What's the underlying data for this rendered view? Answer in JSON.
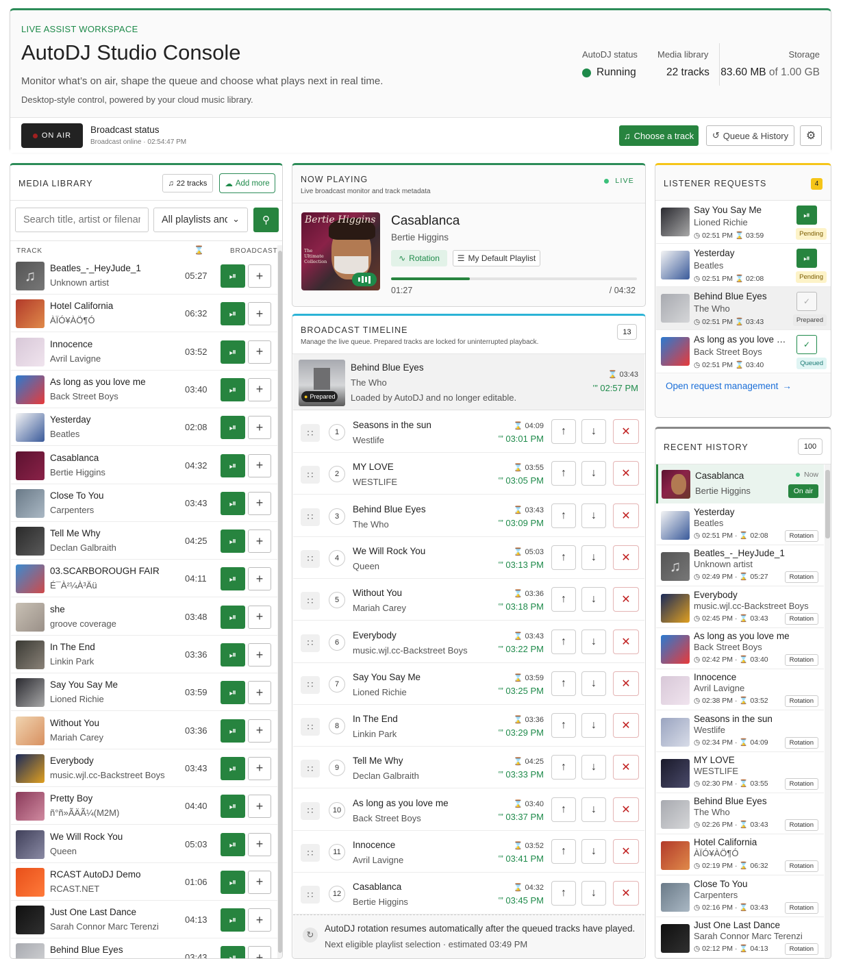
{
  "header": {
    "workspace_label": "LIVE ASSIST WORKSPACE",
    "title": "AutoDJ Studio Console",
    "subtitle": "Monitor what’s on air, shape the queue and choose what plays next in real time.",
    "subtitle2": "Desktop-style control, powered by your cloud music library.",
    "autodj_status_label": "AutoDJ status",
    "autodj_status_value": "Running",
    "media_library_label": "Media library",
    "media_library_value": "22 tracks",
    "storage_label": "Storage",
    "storage_used": "83.60 MB",
    "storage_of": "of 1.00 GB"
  },
  "toolbar": {
    "on_air": "ON AIR",
    "broadcast_status_title": "Broadcast status",
    "broadcast_status_sub": "Broadcast online · 02:54:47 PM",
    "choose_track": "Choose a track",
    "queue_history": "Queue & History"
  },
  "library": {
    "title": "MEDIA LIBRARY",
    "count": "22 tracks",
    "add_more": "Add more",
    "search_placeholder": "Search title, artist or filename",
    "playlist_select": "All playlists and tracks",
    "col_track": "TRACK",
    "col_broadcast": "BROADCAST",
    "tracks": [
      {
        "title": "Beatles_-_HeyJude_1",
        "artist": "Unknown artist",
        "duration": "05:27"
      },
      {
        "title": "Hotel California",
        "artist": "ÀÏÓ¥ÀÖ¶Ó",
        "duration": "06:32"
      },
      {
        "title": "Innocence",
        "artist": "Avril Lavigne",
        "duration": "03:52"
      },
      {
        "title": "As long as you love me",
        "artist": "Back Street Boys",
        "duration": "03:40"
      },
      {
        "title": "Yesterday",
        "artist": "Beatles",
        "duration": "02:08"
      },
      {
        "title": "Casablanca",
        "artist": "Bertie Higgins",
        "duration": "04:32"
      },
      {
        "title": "Close To You",
        "artist": "Carpenters",
        "duration": "03:43"
      },
      {
        "title": "Tell Me Why",
        "artist": "Declan Galbraith",
        "duration": "04:25"
      },
      {
        "title": "03.SCARBOROUGH FAIR",
        "artist": "É¯À²¼À³Äü",
        "duration": "04:11"
      },
      {
        "title": "she",
        "artist": "groove coverage",
        "duration": "03:48"
      },
      {
        "title": "In The End",
        "artist": "Linkin Park",
        "duration": "03:36"
      },
      {
        "title": "Say You Say Me",
        "artist": "Lioned Richie",
        "duration": "03:59"
      },
      {
        "title": "Without You",
        "artist": "Mariah Carey",
        "duration": "03:36"
      },
      {
        "title": "Everybody",
        "artist": "music.wjl.cc-Backstreet Boys",
        "duration": "03:43"
      },
      {
        "title": "Pretty Boy",
        "artist": "ñ°ñ»ÃÄÃ¼(M2M)",
        "duration": "04:40"
      },
      {
        "title": "We Will Rock You",
        "artist": "Queen",
        "duration": "05:03"
      },
      {
        "title": "RCAST AutoDJ Demo",
        "artist": "RCAST.NET",
        "duration": "01:06"
      },
      {
        "title": "Just One Last Dance",
        "artist": "Sarah Connor Marc Terenzi",
        "duration": "04:13"
      },
      {
        "title": "Behind Blue Eyes",
        "artist": "",
        "duration": "03:43"
      }
    ]
  },
  "now_playing": {
    "title": "NOW PLAYING",
    "subtitle": "Live broadcast monitor and track metadata",
    "live": "LIVE",
    "track": "Casablanca",
    "artist": "Bertie Higgins",
    "tag_rotation": "Rotation",
    "tag_playlist": "My Default Playlist",
    "elapsed": "01:27",
    "total": "/ 04:32",
    "progress": 0.32,
    "art_text": "Bertie Higgins",
    "art_small": "The Ultimate Collection"
  },
  "timeline": {
    "title": "BROADCAST TIMELINE",
    "subtitle": "Manage the live queue. Prepared tracks are locked for uninterrupted playback.",
    "count": "13",
    "prepared": {
      "title": "Behind Blue Eyes",
      "artist": "The Who",
      "note": "Loaded by AutoDJ and no longer editable.",
      "duration": "03:43",
      "eta": "02:57 PM",
      "badge": "Prepared"
    },
    "items": [
      {
        "n": "1",
        "title": "Seasons in the sun",
        "artist": "Westlife",
        "duration": "04:09",
        "eta": "03:01 PM"
      },
      {
        "n": "2",
        "title": "MY LOVE",
        "artist": "WESTLIFE",
        "duration": "03:55",
        "eta": "03:05 PM"
      },
      {
        "n": "3",
        "title": "Behind Blue Eyes",
        "artist": "The Who",
        "duration": "03:43",
        "eta": "03:09 PM"
      },
      {
        "n": "4",
        "title": "We Will Rock You",
        "artist": "Queen",
        "duration": "05:03",
        "eta": "03:13 PM"
      },
      {
        "n": "5",
        "title": "Without You",
        "artist": "Mariah Carey",
        "duration": "03:36",
        "eta": "03:18 PM"
      },
      {
        "n": "6",
        "title": "Everybody",
        "artist": "music.wjl.cc-Backstreet Boys",
        "duration": "03:43",
        "eta": "03:22 PM"
      },
      {
        "n": "7",
        "title": "Say You Say Me",
        "artist": "Lioned Richie",
        "duration": "03:59",
        "eta": "03:25 PM"
      },
      {
        "n": "8",
        "title": "In The End",
        "artist": "Linkin Park",
        "duration": "03:36",
        "eta": "03:29 PM"
      },
      {
        "n": "9",
        "title": "Tell Me Why",
        "artist": "Declan Galbraith",
        "duration": "04:25",
        "eta": "03:33 PM"
      },
      {
        "n": "10",
        "title": "As long as you love me",
        "artist": "Back Street Boys",
        "duration": "03:40",
        "eta": "03:37 PM"
      },
      {
        "n": "11",
        "title": "Innocence",
        "artist": "Avril Lavigne",
        "duration": "03:52",
        "eta": "03:41 PM"
      },
      {
        "n": "12",
        "title": "Casablanca",
        "artist": "Bertie Higgins",
        "duration": "04:32",
        "eta": "03:45 PM"
      }
    ],
    "footer_main": "AutoDJ rotation resumes automatically after the queued tracks have played.",
    "footer_sub": "Next eligible playlist selection · estimated 03:49 PM"
  },
  "requests": {
    "title": "LISTENER REQUESTS",
    "count": "4",
    "items": [
      {
        "title": "Say You Say Me",
        "artist": "Lioned Richie",
        "time": "02:51 PM",
        "duration": "03:59",
        "status": "Pending"
      },
      {
        "title": "Yesterday",
        "artist": "Beatles",
        "time": "02:51 PM",
        "duration": "02:08",
        "status": "Pending"
      },
      {
        "title": "Behind Blue Eyes",
        "artist": "The Who",
        "time": "02:51 PM",
        "duration": "03:43",
        "status": "Prepared"
      },
      {
        "title": "As long as you love …",
        "artist": "Back Street Boys",
        "time": "02:51 PM",
        "duration": "03:40",
        "status": "Queued"
      }
    ],
    "open_link": "Open request management"
  },
  "history": {
    "title": "RECENT HISTORY",
    "count": "100",
    "current": {
      "title": "Casablanca",
      "artist": "Bertie Higgins",
      "now": "Now",
      "badge": "On air"
    },
    "items": [
      {
        "title": "Yesterday",
        "artist": "Beatles",
        "time": "02:51 PM",
        "duration": "02:08",
        "tag": "Rotation"
      },
      {
        "title": "Beatles_-_HeyJude_1",
        "artist": "Unknown artist",
        "time": "02:49 PM",
        "duration": "05:27",
        "tag": "Rotation"
      },
      {
        "title": "Everybody",
        "artist": "music.wjl.cc-Backstreet Boys",
        "time": "02:45 PM",
        "duration": "03:43",
        "tag": "Rotation"
      },
      {
        "title": "As long as you love me",
        "artist": "Back Street Boys",
        "time": "02:42 PM",
        "duration": "03:40",
        "tag": "Rotation"
      },
      {
        "title": "Innocence",
        "artist": "Avril Lavigne",
        "time": "02:38 PM",
        "duration": "03:52",
        "tag": "Rotation"
      },
      {
        "title": "Seasons in the sun",
        "artist": "Westlife",
        "time": "02:34 PM",
        "duration": "04:09",
        "tag": "Rotation"
      },
      {
        "title": "MY LOVE",
        "artist": "WESTLIFE",
        "time": "02:30 PM",
        "duration": "03:55",
        "tag": "Rotation"
      },
      {
        "title": "Behind Blue Eyes",
        "artist": "The Who",
        "time": "02:26 PM",
        "duration": "03:43",
        "tag": "Rotation"
      },
      {
        "title": "Hotel California",
        "artist": "ÀÏÓ¥ÀÖ¶Ó",
        "time": "02:19 PM",
        "duration": "06:32",
        "tag": "Rotation"
      },
      {
        "title": "Close To You",
        "artist": "Carpenters",
        "time": "02:16 PM",
        "duration": "03:43",
        "tag": "Rotation"
      },
      {
        "title": "Just One Last Dance",
        "artist": "Sarah Connor Marc Terenzi",
        "time": "02:12 PM",
        "duration": "04:13",
        "tag": "Rotation"
      }
    ]
  },
  "colors": {
    "accent_green": "#27843f",
    "status_green": "#1e8a4a",
    "request_yellow": "#f5c518",
    "timeline_cyan": "#2bb3d6"
  }
}
